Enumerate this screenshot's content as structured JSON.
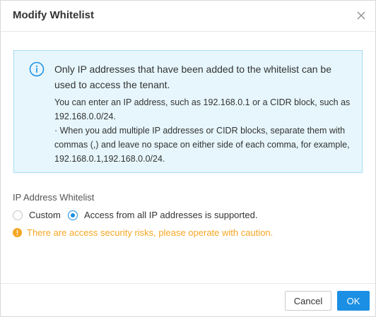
{
  "dialog": {
    "title": "Modify Whitelist",
    "close_icon": "close-icon"
  },
  "info": {
    "icon": "info-icon",
    "main_text": "Only IP addresses that have been added to the whitelist can be used to access the tenant.",
    "sub_line_1": "You can enter an IP address, such as 192.168.0.1 or a CIDR block, such as 192.168.0.0/24.",
    "sub_line_2": "· When you add multiple IP addresses or CIDR blocks, separate them with commas (,) and leave no space on either side of each comma, for example, 192.168.0.1,192.168.0.0/24."
  },
  "whitelist": {
    "label": "IP Address Whitelist",
    "options": [
      {
        "label": "Custom",
        "selected": false
      },
      {
        "label": "Access from all IP addresses is supported.",
        "selected": true
      }
    ],
    "warning_icon": "warning-icon",
    "warning_text": "There are access security risks, please operate with caution."
  },
  "footer": {
    "cancel_label": "Cancel",
    "ok_label": "OK"
  },
  "colors": {
    "accent": "#1a8fe3",
    "info_bg": "#e6f6fc",
    "info_border": "#a8ddf2",
    "warning": "#f5a623"
  }
}
